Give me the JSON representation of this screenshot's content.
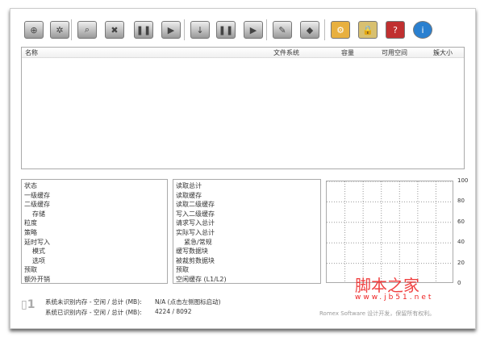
{
  "toolbar": [
    {
      "name": "add-disk-button",
      "glyph": "⊕"
    },
    {
      "name": "settings-disk-button",
      "glyph": "✲"
    },
    {
      "name": "search-disk-button",
      "glyph": "⌕"
    },
    {
      "name": "remove-disk-button",
      "glyph": "✖"
    },
    {
      "name": "pause-disk-button",
      "glyph": "❚❚"
    },
    {
      "name": "play-disk-button",
      "glyph": "▶"
    },
    {
      "name": "flush-button",
      "glyph": "↓"
    },
    {
      "name": "pause-all-button",
      "glyph": "❚❚"
    },
    {
      "name": "start-all-button",
      "glyph": "▶"
    },
    {
      "name": "edit-button",
      "glyph": "✎"
    },
    {
      "name": "chip-button",
      "glyph": "◆"
    },
    {
      "name": "options-button",
      "glyph": "⚙"
    },
    {
      "name": "license-button",
      "glyph": "🔒"
    },
    {
      "name": "help-button",
      "glyph": "?"
    },
    {
      "name": "about-button",
      "glyph": "i"
    }
  ],
  "list": {
    "columns": [
      "名称",
      "文件系统",
      "容量",
      "可用空间",
      "簇大小"
    ]
  },
  "left_panel": [
    "状态",
    "一级缓存",
    "二级缓存",
    "存储",
    "粒度",
    "策略",
    "延时写入",
    "模式",
    "选项",
    "预取",
    "额外开销"
  ],
  "mid_panel": [
    "读取总计",
    "读取缓存",
    "读取二级缓存",
    "写入二级缓存",
    "请求写入总计",
    "实际写入总计",
    "紧急/常规",
    "缓写数据块",
    "被裁剪数据块",
    "预取",
    "空闲缓存 (L1/L2)"
  ],
  "chart_data": {
    "type": "line",
    "series": [],
    "ylim": [
      0,
      100
    ],
    "yticks": [
      "100",
      "80",
      "60",
      "40",
      "20",
      "0"
    ],
    "grid": true
  },
  "status": {
    "row1_label": "系统未识别内存 - 空闲 / 总计 (MB):",
    "row1_value": "N/A (点击左侧图标启动)",
    "row2_label": "系统已识别内存 - 空闲 / 总计 (MB):",
    "row2_value": "4224 / 8092",
    "copyright": "Romex Software 设计开发，保留所有权利。"
  },
  "watermark": {
    "title": "脚本之家",
    "url": "www.jb51.net"
  }
}
